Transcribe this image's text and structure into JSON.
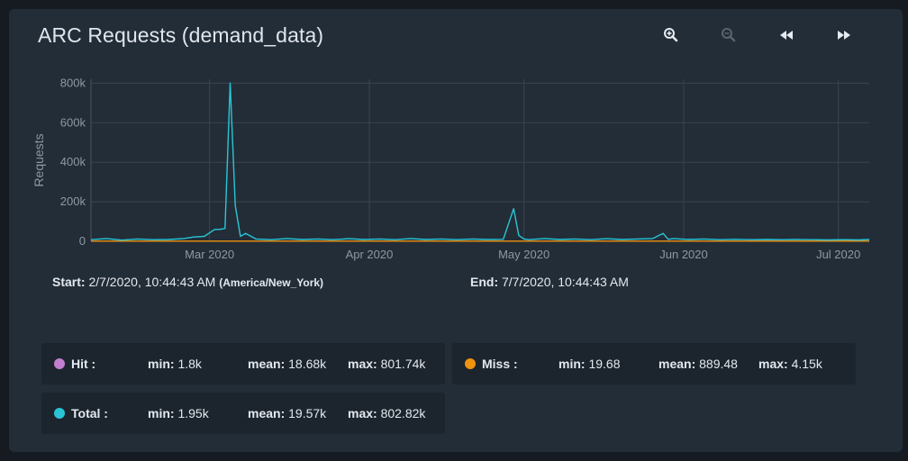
{
  "title": "ARC Requests (demand_data)",
  "toolbar": [
    {
      "name": "zoom-in-icon"
    },
    {
      "name": "zoom-out-icon"
    },
    {
      "name": "step-back-icon"
    },
    {
      "name": "step-forward-icon"
    }
  ],
  "range": {
    "start_label": "Start:",
    "start_value": "2/7/2020, 10:44:43 AM",
    "timezone": "(America/New_York)",
    "end_label": "End:",
    "end_value": "7/7/2020, 10:44:43 AM"
  },
  "colors": {
    "hit": "#c17fcf",
    "miss": "#f0930f",
    "total": "#29c5d6",
    "grid": "#3a444e",
    "axis_text": "#8e98a3"
  },
  "legend": [
    {
      "name": "Hit :",
      "color": "#c17fcf",
      "min_label": "min:",
      "min": "1.8k",
      "mean_label": "mean:",
      "mean": "18.68k",
      "max_label": "max:",
      "max": "801.74k"
    },
    {
      "name": "Miss :",
      "color": "#f0930f",
      "min_label": "min:",
      "min": "19.68",
      "mean_label": "mean:",
      "mean": "889.48",
      "max_label": "max:",
      "max": "4.15k"
    },
    {
      "name": "Total :",
      "color": "#29c5d6",
      "min_label": "min:",
      "min": "1.95k",
      "mean_label": "mean:",
      "mean": "19.57k",
      "max_label": "max:",
      "max": "802.82k"
    }
  ],
  "chart_data": {
    "type": "line",
    "ylabel": "Requests",
    "xlabel": "",
    "y_ticks": [
      "0",
      "200k",
      "400k",
      "600k",
      "800k"
    ],
    "y_tick_values": [
      0,
      200000,
      400000,
      600000,
      800000
    ],
    "ylim": [
      0,
      820000
    ],
    "x_ticks": [
      "Mar 2020",
      "Apr 2020",
      "May 2020",
      "Jun 2020",
      "Jul 2020"
    ],
    "x_tick_dates": [
      "2020-03-01",
      "2020-04-01",
      "2020-05-01",
      "2020-06-01",
      "2020-07-01"
    ],
    "xlim": [
      "2020-02-07",
      "2020-07-07"
    ],
    "grid": true,
    "series": [
      {
        "name": "Total",
        "x": [
          "2020-02-07",
          "2020-02-10",
          "2020-02-13",
          "2020-02-16",
          "2020-02-19",
          "2020-02-22",
          "2020-02-25",
          "2020-02-27",
          "2020-02-29",
          "2020-03-02",
          "2020-03-03",
          "2020-03-04",
          "2020-03-05",
          "2020-03-06",
          "2020-03-07",
          "2020-03-08",
          "2020-03-10",
          "2020-03-13",
          "2020-03-16",
          "2020-03-19",
          "2020-03-22",
          "2020-03-25",
          "2020-03-28",
          "2020-03-31",
          "2020-04-03",
          "2020-04-06",
          "2020-04-09",
          "2020-04-12",
          "2020-04-15",
          "2020-04-18",
          "2020-04-21",
          "2020-04-24",
          "2020-04-27",
          "2020-04-29",
          "2020-04-30",
          "2020-05-01",
          "2020-05-02",
          "2020-05-05",
          "2020-05-08",
          "2020-05-11",
          "2020-05-14",
          "2020-05-17",
          "2020-05-20",
          "2020-05-23",
          "2020-05-26",
          "2020-05-28",
          "2020-05-29",
          "2020-05-30",
          "2020-06-02",
          "2020-06-05",
          "2020-06-08",
          "2020-06-11",
          "2020-06-14",
          "2020-06-17",
          "2020-06-20",
          "2020-06-23",
          "2020-06-26",
          "2020-06-29",
          "2020-07-02",
          "2020-07-05",
          "2020-07-07"
        ],
        "y": [
          8000,
          14000,
          6000,
          12000,
          8000,
          9000,
          14000,
          22000,
          25000,
          60000,
          60000,
          65000,
          801000,
          180000,
          25000,
          40000,
          12000,
          8000,
          14000,
          9000,
          12000,
          8000,
          13000,
          9000,
          12000,
          8000,
          14000,
          9000,
          12000,
          8000,
          12000,
          9000,
          10000,
          165000,
          30000,
          12000,
          8000,
          14000,
          9000,
          12000,
          8000,
          13000,
          9000,
          12000,
          14000,
          40000,
          10000,
          14000,
          9000,
          12000,
          8000,
          10000,
          8000,
          9000,
          8000,
          9000,
          8000,
          7000,
          8000,
          7000,
          9000
        ]
      },
      {
        "name": "Miss",
        "x": [
          "2020-02-07",
          "2020-03-05",
          "2020-04-01",
          "2020-05-01",
          "2020-06-01",
          "2020-07-07"
        ],
        "y": [
          900,
          1100,
          900,
          800,
          900,
          900
        ]
      }
    ]
  }
}
